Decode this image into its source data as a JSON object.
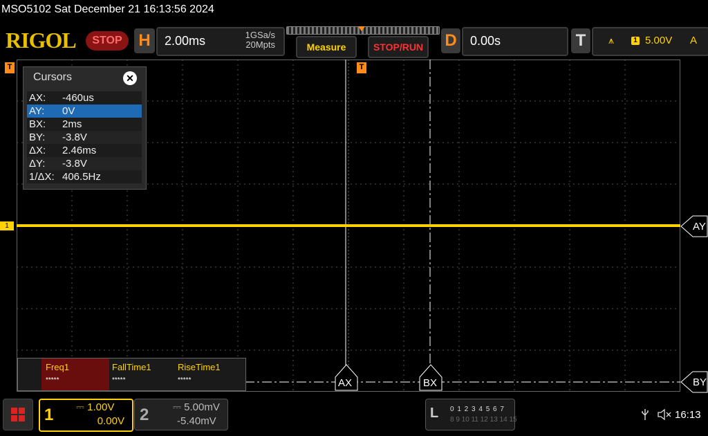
{
  "status_line": "MSO5102  Sat December 21 16:13:56 2024",
  "brand": {
    "logo": "RIGOL",
    "run_state": "STOP"
  },
  "horizontal": {
    "letter": "H",
    "timebase": "2.00ms",
    "sample_rate": "1GSa/s",
    "memory_depth": "20Mpts"
  },
  "buttons": {
    "measure": "Measure",
    "stop_run": "STOP/RUN"
  },
  "delay": {
    "letter": "D",
    "value": "0.00s"
  },
  "trigger": {
    "letter": "T",
    "source": "1",
    "level": "5.00V",
    "mode": "A",
    "marker": "T"
  },
  "cursors": {
    "title": "Cursors",
    "rows": [
      {
        "key": "AX:",
        "value": "-460us",
        "selected": false
      },
      {
        "key": "AY:",
        "value": "0V",
        "selected": true
      },
      {
        "key": "BX:",
        "value": "2ms",
        "selected": false
      },
      {
        "key": "BY:",
        "value": "-3.8V",
        "selected": false
      },
      {
        "key": "ΔX:",
        "value": "2.46ms",
        "selected": false
      },
      {
        "key": "ΔY:",
        "value": "-3.8V",
        "selected": false
      },
      {
        "key": "1/ΔX:",
        "value": "406.5Hz",
        "selected": false
      }
    ]
  },
  "cursor_labels": {
    "ax": "AX",
    "bx": "BX",
    "ay": "AY",
    "by": "BY"
  },
  "measurements": [
    {
      "label": "Freq1",
      "value": "*****",
      "highlight": true
    },
    {
      "label": "FallTime1",
      "value": "*****",
      "highlight": false
    },
    {
      "label": "RiseTime1",
      "value": "*****",
      "highlight": false
    }
  ],
  "channel1": {
    "number": "1",
    "scale": "1.00V",
    "offset": "0.00V",
    "color": "#ffd200"
  },
  "channel2": {
    "number": "2",
    "scale": "5.00mV",
    "offset": "-5.40mV"
  },
  "logic": {
    "letter": "L",
    "bits_low": "0 1 2 3  4 5 6 7",
    "bits_high": "8 9 10 11 12 13 14 15"
  },
  "clock": "16:13",
  "colors": {
    "ch1": "#ffd200",
    "trigger": "#ff8c1a",
    "stop": "#ff3030"
  }
}
